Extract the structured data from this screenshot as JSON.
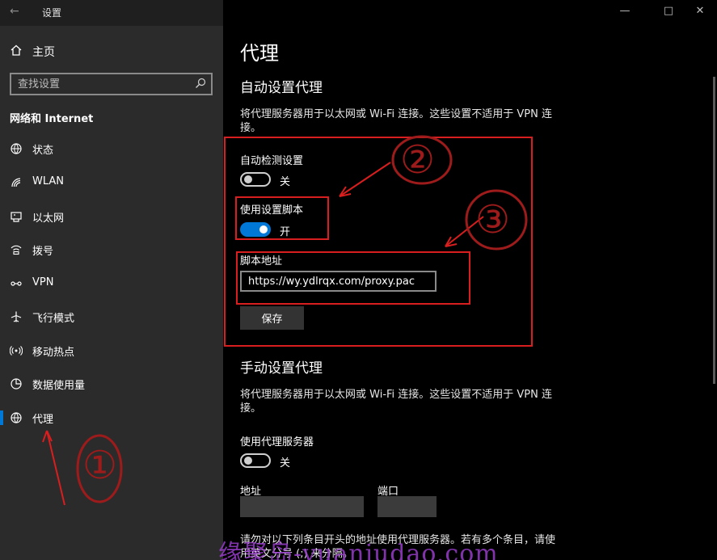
{
  "window": {
    "title": "设置",
    "back_icon": "back-arrow-icon"
  },
  "sidebar": {
    "home_label": "主页",
    "search_placeholder": "查找设置",
    "section_title": "网络和 Internet",
    "items": [
      {
        "label": "状态",
        "icon": "globe-status-icon"
      },
      {
        "label": "WLAN",
        "icon": "wifi-icon"
      },
      {
        "label": "以太网",
        "icon": "ethernet-icon"
      },
      {
        "label": "拨号",
        "icon": "dialup-icon"
      },
      {
        "label": "VPN",
        "icon": "vpn-icon"
      },
      {
        "label": "飞行模式",
        "icon": "airplane-icon"
      },
      {
        "label": "移动热点",
        "icon": "hotspot-icon"
      },
      {
        "label": "数据使用量",
        "icon": "data-usage-icon"
      },
      {
        "label": "代理",
        "icon": "globe-icon",
        "active": true
      }
    ]
  },
  "main": {
    "page_title": "代理",
    "auto": {
      "title": "自动设置代理",
      "desc": "将代理服务器用于以太网或 Wi-Fi 连接。这些设置不适用于 VPN 连接。",
      "detect_label": "自动检测设置",
      "detect_state": "关",
      "script_label": "使用设置脚本",
      "script_state": "开",
      "address_label": "脚本地址",
      "address_value": "https://wy.ydlrqx.com/proxy.pac",
      "save_label": "保存"
    },
    "manual": {
      "title": "手动设置代理",
      "desc": "将代理服务器用于以太网或 Wi-Fi 连接。这些设置不适用于 VPN 连接。",
      "use_label": "使用代理服务器",
      "use_state": "关",
      "address_label": "地址",
      "port_label": "端口",
      "bottom_text": "请勿对以下列条目开头的地址使用代理服务器。若有多个条目，请使用英文分号 (;) 来分隔。"
    }
  },
  "annotations": {
    "marks": [
      "①",
      "②",
      "③"
    ],
    "color": "#d81e1e"
  },
  "watermark": "缘聚岛-yuanjudao.com",
  "colors": {
    "accent": "#0078d7",
    "sidebar_bg": "#2b2b2b",
    "main_bg": "#000000"
  }
}
